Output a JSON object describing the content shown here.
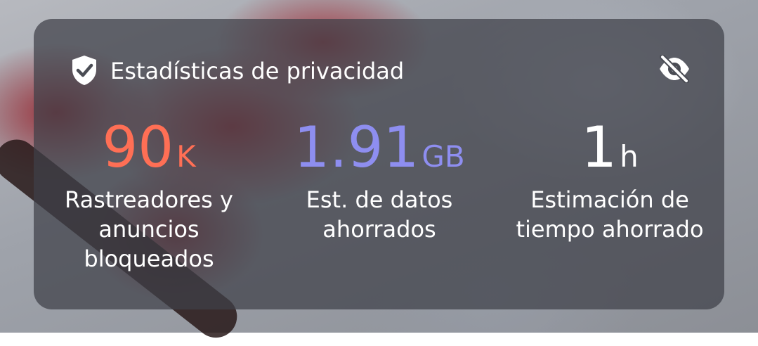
{
  "widget": {
    "title": "Estadísticas de privacidad",
    "title_icon": "shield-check-icon",
    "hide_icon": "eye-off-icon"
  },
  "stats": [
    {
      "value": "90",
      "unit": "K",
      "label": "Rastreadores y anuncios bloqueados",
      "color": "#ff6f55"
    },
    {
      "value": "1.91",
      "unit": "GB",
      "label": "Est. de datos ahorrados",
      "color": "#8e8ef0"
    },
    {
      "value": "1",
      "unit": "h",
      "label": "Estimación de tiempo ahorrado",
      "color": "#ffffff"
    }
  ]
}
